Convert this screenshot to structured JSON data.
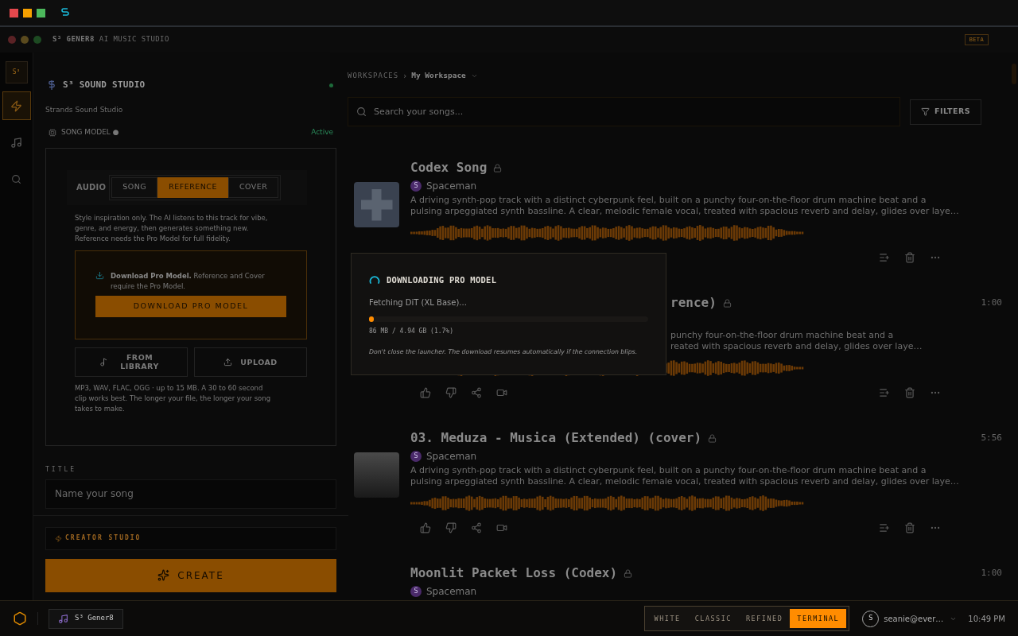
{
  "app_title": {
    "name": "S³ GENER8",
    "subtitle": "AI MUSIC STUDIO",
    "badge": "BETA"
  },
  "rail": {
    "logo": "S³",
    "items": [
      {
        "kind": "bolt",
        "selected": true
      },
      {
        "kind": "music",
        "selected": false
      },
      {
        "kind": "search",
        "selected": false
      }
    ]
  },
  "studio": {
    "title": "S³ SOUND STUDIO",
    "subtitle": "Strands Sound Studio",
    "online": true,
    "model_label": "SONG MODEL ●",
    "model_status": "Active",
    "audio_label": "AUDIO",
    "modes": [
      {
        "label": "SONG",
        "selected": false
      },
      {
        "label": "REFERENCE",
        "selected": true
      },
      {
        "label": "COVER",
        "selected": false
      }
    ],
    "mode_help": "Style inspiration only. The AI listens to this track for vibe, genre, and energy, then generates something new. Reference needs the Pro Model for full fidelity.",
    "pro_notice": "**Download Pro Model.** Reference and Cover require the Pro Model.",
    "pro_button": "DOWNLOAD PRO MODEL",
    "sources": [
      {
        "kind": "library",
        "label": "FROM LIBRARY"
      },
      {
        "kind": "upload",
        "label": "UPLOAD"
      }
    ],
    "file_help": "MP3, WAV, FLAC, OGG · up to 15 MB. A 30 to 60 second clip works best. The longer your file, the longer your song takes to make.",
    "title_label": "TITLE",
    "title_placeholder": "Name your song",
    "creator_label": "CREATOR STUDIO",
    "create_button": "CREATE"
  },
  "breadcrumb": {
    "root": "WORKSPACES",
    "separator": "›",
    "current": "My Workspace"
  },
  "search": {
    "placeholder": "Search your songs..."
  },
  "filters_button": "FILTERS",
  "songs": [
    {
      "kind": "icon-art",
      "title": "Codex Song",
      "artist": "Spaceman",
      "avatar": "S",
      "description_lines": [
        "A driving synth-pop track with a distinct cyberpunk feel, built on a punchy four-on-the-floor drum machine beat and a",
        "pulsing arpeggiated synth bassline. A clear, melodic female vocal, treated with spacious reverb and delay, glides over laye…"
      ]
    },
    {
      "kind": "covered",
      "title": "rence)",
      "duration": "1:00",
      "feedback_actions": true,
      "description_lines": [
        "punchy four-on-the-floor drum machine beat and a",
        "reated with spacious reverb and delay, glides over laye…"
      ]
    },
    {
      "kind": "photo",
      "title": "03. Meduza - Musica (Extended) (cover)",
      "artist": "Spaceman",
      "avatar": "S",
      "duration": "5:56",
      "feedback_actions": true,
      "description_lines": [
        "A driving synth-pop track with a distinct cyberpunk feel, built on a punchy four-on-the-floor drum machine beat and a",
        "pulsing arpeggiated synth bassline. A clear, melodic female vocal, treated with spacious reverb and delay, glides over laye…"
      ]
    },
    {
      "kind": "plain",
      "title": "Moonlit Packet Loss (Codex)",
      "artist": "Spaceman",
      "avatar": "S",
      "duration": "1:00"
    }
  ],
  "download_dialog": {
    "title": "DOWNLOADING PRO MODEL",
    "status": "Fetching DiT (XL Base)...",
    "level": 0.017,
    "progress_text": "86 MB / 4.94 GB (1.7%)",
    "note": "Don't close the launcher. The download resumes automatically if the connection blips."
  },
  "taskbar": {
    "app": "S³ Gener8",
    "themes": [
      {
        "label": "WHITE",
        "selected": false
      },
      {
        "label": "CLASSIC",
        "selected": false
      },
      {
        "label": "REFINED",
        "selected": false
      },
      {
        "label": "TERMINAL",
        "selected": true
      }
    ],
    "user_avatar": "S",
    "user": "seanie@ever…",
    "clock": "10:49 PM"
  }
}
